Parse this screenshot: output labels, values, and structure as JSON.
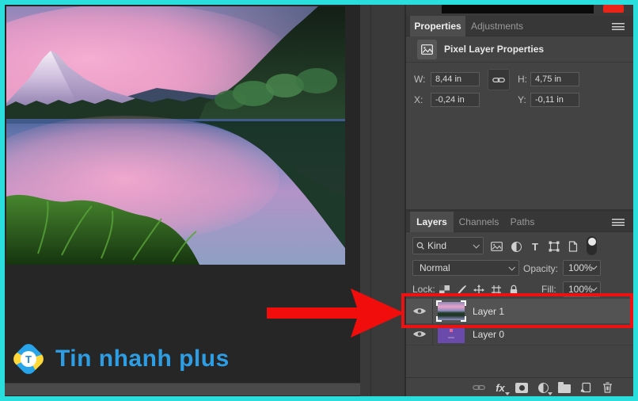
{
  "colors": {
    "frame_border": "#2bdede",
    "annotation_red": "#ee1111",
    "logo_blue": "#2d9de4"
  },
  "properties_panel": {
    "tabs": [
      {
        "label": "Properties"
      },
      {
        "label": "Adjustments"
      }
    ],
    "header_title": "Pixel Layer Properties",
    "fields": {
      "w_label": "W:",
      "w_value": "8,44 in",
      "h_label": "H:",
      "h_value": "4,75 in",
      "x_label": "X:",
      "x_value": "-0,24 in",
      "y_label": "Y:",
      "y_value": "-0,11 in"
    }
  },
  "layers_panel": {
    "tabs": [
      {
        "label": "Layers"
      },
      {
        "label": "Channels"
      },
      {
        "label": "Paths"
      }
    ],
    "filter": {
      "kind_label": "Kind"
    },
    "blend_mode": "Normal",
    "opacity_label": "Opacity:",
    "opacity_value": "100%",
    "lock_label": "Lock:",
    "fill_label": "Fill:",
    "fill_value": "100%",
    "icons": {
      "text_tool": "T",
      "effects": "fx"
    },
    "layers": [
      {
        "name": "Layer 1"
      },
      {
        "name": "Layer 0"
      }
    ]
  },
  "watermark": {
    "text": "Tin nhanh plus",
    "icon_letter": "T"
  }
}
